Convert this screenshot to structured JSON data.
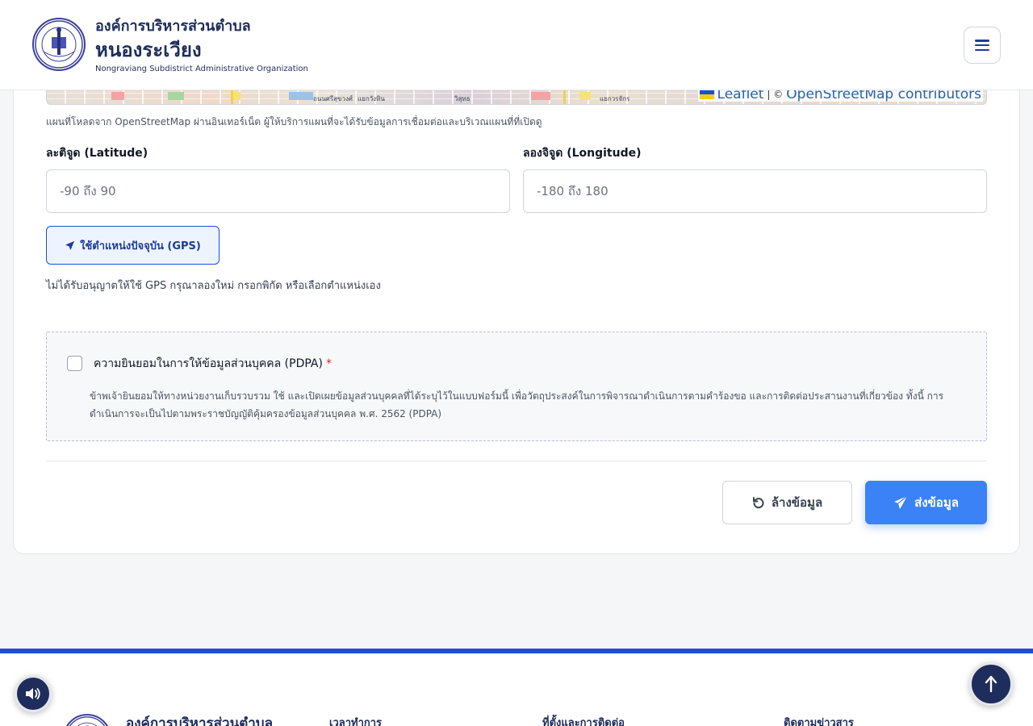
{
  "header": {
    "org_title": "องค์การบริหารส่วนตำบล",
    "org_name": "หนองระเวียง",
    "org_name_en": "Nongraviang Subdistrict Administrative Organization",
    "menu_icon": "hamburger-menu-icon"
  },
  "map": {
    "labels": [
      "ถนนศรีสุขวงศ์",
      "แยกวังหิน",
      "วิสุทธ",
      "แยกวรจักร"
    ],
    "attribution_leaflet": "Leaflet",
    "attribution_sep": "| ©",
    "attribution_osm": "OpenStreetMap contributors",
    "note": "แผนที่โหลดจาก OpenStreetMap ผ่านอินเทอร์เน็ต ผู้ให้บริการแผนที่จะได้รับข้อมูลการเชื่อมต่อและบริเวณแผนที่ที่เปิดดู"
  },
  "coords": {
    "latitude_label": "ละติจูด (Latitude)",
    "latitude_placeholder": "-90 ถึง 90",
    "latitude_value": "",
    "longitude_label": "ลองจิจูด (Longitude)",
    "longitude_placeholder": "-180 ถึง 180",
    "longitude_value": ""
  },
  "gps": {
    "button_label": "ใช้ตำแหน่งปัจจุบัน (GPS)",
    "note": "ไม่ได้รับอนุญาตให้ใช้ GPS กรุณาลองใหม่ กรอกพิกัด หรือเลือกตำแหน่งเอง"
  },
  "pdpa": {
    "checked": false,
    "title": "ความยินยอมในการให้ข้อมูลส่วนบุคคล (PDPA)",
    "required_mark": "*",
    "description": "ข้าพเจ้ายินยอมให้ทางหน่วยงานเก็บรวบรวม ใช้ และเปิดเผยข้อมูลส่วนบุคคลที่ได้ระบุไว้ในแบบฟอร์มนี้ เพื่อวัตถุประสงค์ในการพิจารณาดำเนินการตามคำร้องขอ และการติดต่อประสานงานที่เกี่ยวข้อง ทั้งนี้ การดำเนินการจะเป็นไปตามพระราชบัญญัติคุ้มครองข้อมูลส่วนบุคคล พ.ศ. 2562 (PDPA)"
  },
  "actions": {
    "clear_label": "ล้างข้อมูล",
    "submit_label": "ส่งข้อมูล"
  },
  "footer": {
    "org_title": "องค์การบริหารส่วนตำบล",
    "col_hours": "เวลาทำการ",
    "col_contact": "ที่ตั้งและการติดต่อ",
    "col_news": "ติดตามข่าวสาร"
  },
  "colors": {
    "brand_navy": "#1e2d5c",
    "accent_blue": "#3b82f6",
    "footer_border": "#1d4ed8",
    "required_red": "#dc2626"
  }
}
